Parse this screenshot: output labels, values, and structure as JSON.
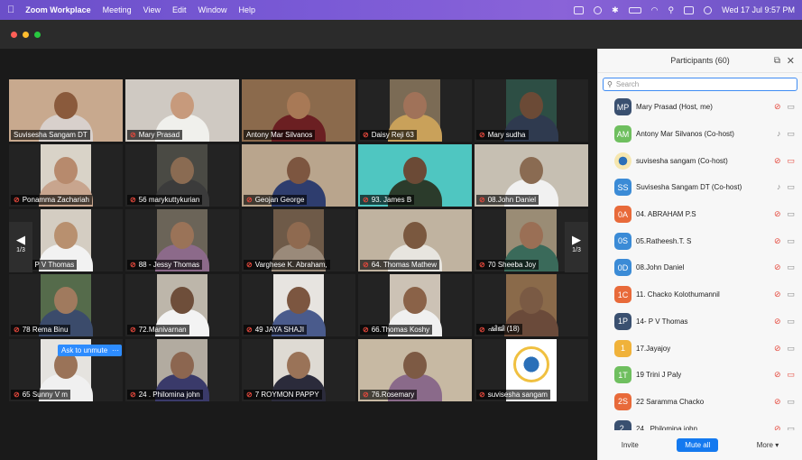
{
  "menubar": {
    "app_name": "Zoom Workplace",
    "items": [
      "Meeting",
      "View",
      "Edit",
      "Window",
      "Help"
    ],
    "clock": "Wed 17 Jul  9:57 PM"
  },
  "gallery": {
    "page_indicator_left": "1/3",
    "page_indicator_right": "1/3",
    "ask_to_unmute": "Ask to unmute",
    "ask_more": "···",
    "tiles": [
      {
        "name": "Suvisesha Sangam DT",
        "muted": false,
        "active": true,
        "bg": "#c8a98e",
        "skin": "#8a5a3c",
        "shirt": "#d8d0cc",
        "w": 126
      },
      {
        "name": "Mary Prasad",
        "muted": true,
        "bg": "#cfc9c2",
        "skin": "#c79a7c",
        "shirt": "#f0f0ec",
        "w": 126
      },
      {
        "name": "Antony Mar Silvanos",
        "muted": false,
        "bg": "#8b6a4c",
        "skin": "#a87956",
        "shirt": "#6b1f22",
        "w": 126
      },
      {
        "name": "Daisy Reji 63",
        "muted": true,
        "bg": "#7b6b55",
        "skin": "#a07259",
        "shirt": "#c9a15a",
        "w": 56
      },
      {
        "name": "Mary sudha",
        "muted": true,
        "bg": "#2d4e44",
        "skin": "#6b4a36",
        "shirt": "#2f3a4f",
        "w": 56
      },
      {
        "name": "Ponamma Zachariah",
        "muted": true,
        "bg": "#d9d3c8",
        "skin": "#b78a6d",
        "shirt": "#c8a58e",
        "w": 56
      },
      {
        "name": "56  marykuttykurian",
        "muted": true,
        "bg": "#4a4a44",
        "skin": "#8a6b52",
        "shirt": "#3b3b3b",
        "w": 56
      },
      {
        "name": "Geojan George",
        "muted": true,
        "bg": "#b9a58d",
        "skin": "#7d5640",
        "shirt": "#2e3d6e",
        "w": 126
      },
      {
        "name": "93. James B",
        "muted": true,
        "bg": "#4fc6c1",
        "skin": "#6b4a36",
        "shirt": "#2b3b2b",
        "w": 126
      },
      {
        "name": "08.John Daniel",
        "muted": true,
        "bg": "#c6bfb2",
        "skin": "#8a6b52",
        "shirt": "#f1f1f1",
        "w": 126
      },
      {
        "name": "14- P V Thomas",
        "muted": true,
        "bg": "#d4cdc2",
        "skin": "#b8906f",
        "shirt": "#f2f2f2",
        "w": 56
      },
      {
        "name": "88 - Jessy Thomas",
        "muted": true,
        "bg": "#6b6458",
        "skin": "#9a7358",
        "shirt": "#8c6a8a",
        "w": 56
      },
      {
        "name": "Varghese K. Abraham,",
        "muted": true,
        "bg": "#6e5a48",
        "skin": "#8f6a50",
        "shirt": "#9a8a7a",
        "w": 56
      },
      {
        "name": "64. Thomas Mathew",
        "muted": true,
        "bg": "#c0b3a0",
        "skin": "#7a583f",
        "shirt": "#e7e5df",
        "w": 126
      },
      {
        "name": "70  Sheeba Joy",
        "muted": true,
        "bg": "#9a8c75",
        "skin": "#9a6f55",
        "shirt": "#3a6a5a",
        "w": 56
      },
      {
        "name": "78 Rema Binu",
        "muted": true,
        "bg": "#556b4b",
        "skin": "#a07a5e",
        "shirt": "#3b4b6b",
        "w": 56
      },
      {
        "name": "72.Manivarnan",
        "muted": true,
        "bg": "#bdb6aa",
        "skin": "#6e4e3a",
        "shirt": "#f3f3f3",
        "w": 56
      },
      {
        "name": "49 JAYA SHAJI",
        "muted": true,
        "bg": "#e7e4e0",
        "skin": "#7c5640",
        "shirt": "#4a5b8c",
        "w": 56
      },
      {
        "name": "66.Thomas Koshy",
        "muted": true,
        "bg": "#ccc2b5",
        "skin": "#8a6248",
        "shirt": "#f0f0f0",
        "w": 56
      },
      {
        "name": "ഷിജി (18)",
        "muted": true,
        "bg": "#8a6a4a",
        "skin": "#7a5a44",
        "shirt": "#6a4a3a",
        "w": 56
      },
      {
        "name": "65 Sunny V m",
        "muted": true,
        "bg": "#e5e3df",
        "skin": "#9a7358",
        "shirt": "#f0f0f0",
        "w": 56
      },
      {
        "name": "24 . Philomina john",
        "muted": true,
        "bg": "#b2aba0",
        "skin": "#8c6650",
        "shirt": "#3a3a6a",
        "w": 56
      },
      {
        "name": "7 ROYMON PAPPY",
        "muted": true,
        "bg": "#dedad3",
        "skin": "#9a7358",
        "shirt": "#2b2b3b",
        "w": 56
      },
      {
        "name": "76.Rosemary",
        "muted": true,
        "bg": "#c7b9a3",
        "skin": "#7d5a44",
        "shirt": "#8a6a8a",
        "w": 126
      },
      {
        "name": "suvisesha sangam",
        "muted": true,
        "bg": "#ffffff",
        "skin": "#f0c040",
        "shirt": "#2a6fb8",
        "w": 56,
        "logo": true
      }
    ]
  },
  "participants": {
    "title": "Participants (60)",
    "search_placeholder": "Search",
    "list": [
      {
        "initials": "MP",
        "color": "#3a5070",
        "name": "Mary Prasad (Host, me)",
        "mic_on": false,
        "video_off": false
      },
      {
        "initials": "AM",
        "color": "#6fbf5f",
        "name": "Antony Mar Silvanos (Co-host)",
        "mic_on": true,
        "video_off": false
      },
      {
        "initials": "",
        "color": "#e8b64a",
        "name": "suvisesha sangam (Co-host)",
        "mic_on": false,
        "video_off": true,
        "logo": true
      },
      {
        "initials": "SS",
        "color": "#3b8bd6",
        "name": "Suvisesha Sangam DT (Co-host)",
        "mic_on": true,
        "video_off": false
      },
      {
        "initials": "0A",
        "color": "#e86a3a",
        "name": "04. ABRAHAM P.S",
        "mic_on": false,
        "video_off": false
      },
      {
        "initials": "0S",
        "color": "#3b8bd6",
        "name": "05.Ratheesh.T. S",
        "mic_on": false,
        "video_off": false
      },
      {
        "initials": "0D",
        "color": "#3b8bd6",
        "name": "08.John Daniel",
        "mic_on": false,
        "video_off": false
      },
      {
        "initials": "1C",
        "color": "#e86a3a",
        "name": "11. Chacko Kolothumannil",
        "mic_on": false,
        "video_off": false
      },
      {
        "initials": "1P",
        "color": "#3a5070",
        "name": "14- P V Thomas",
        "mic_on": false,
        "video_off": false
      },
      {
        "initials": "1",
        "color": "#f0b23a",
        "name": "17.Jayajoy",
        "mic_on": false,
        "video_off": false
      },
      {
        "initials": "1T",
        "color": "#6fbf5f",
        "name": "19 Trini J Paly",
        "mic_on": false,
        "video_off": true
      },
      {
        "initials": "2S",
        "color": "#e86a3a",
        "name": "22 Saramma Chacko",
        "mic_on": false,
        "video_off": false
      },
      {
        "initials": "2.",
        "color": "#3a5070",
        "name": "24 . Philomina john",
        "mic_on": false,
        "video_off": false
      }
    ],
    "footer": {
      "invite": "Invite",
      "mute_all": "Mute all",
      "more": "More ▾"
    }
  }
}
